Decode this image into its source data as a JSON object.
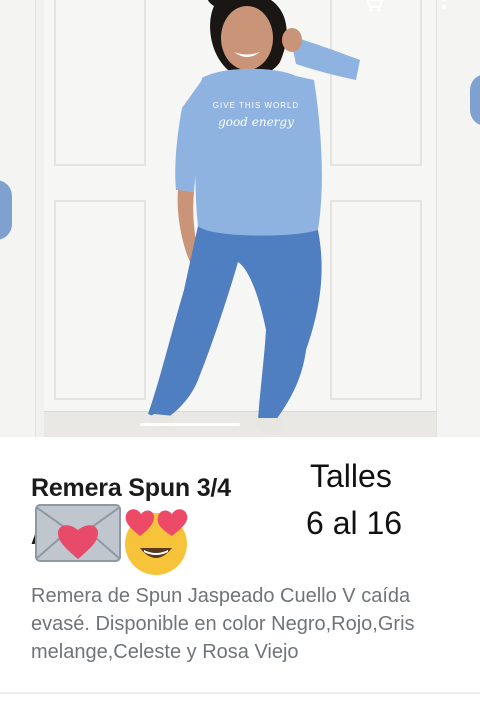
{
  "product": {
    "title": "Remera Spun 3/4",
    "title_second_line": "A",
    "sizes_line_1": "Talles",
    "sizes_line_2": "6 al 16",
    "description": "Remera de Spun Jaspeado Cuello V caída evasé. Disponible en color Negro,Rojo,Gris melange,Celeste y Rosa Viejo"
  },
  "shirt_print": {
    "line1": "GIVE THIS WORLD",
    "line2": "good energy"
  },
  "top_bar": {
    "cart_icon": "cart-icon",
    "menu_icon": "more-vert-icon"
  },
  "colors": {
    "shirt": "#8fb3e0",
    "jeans": "#4f7fc0",
    "text_dark": "#1b1b1b",
    "text_muted": "#6f7479"
  }
}
